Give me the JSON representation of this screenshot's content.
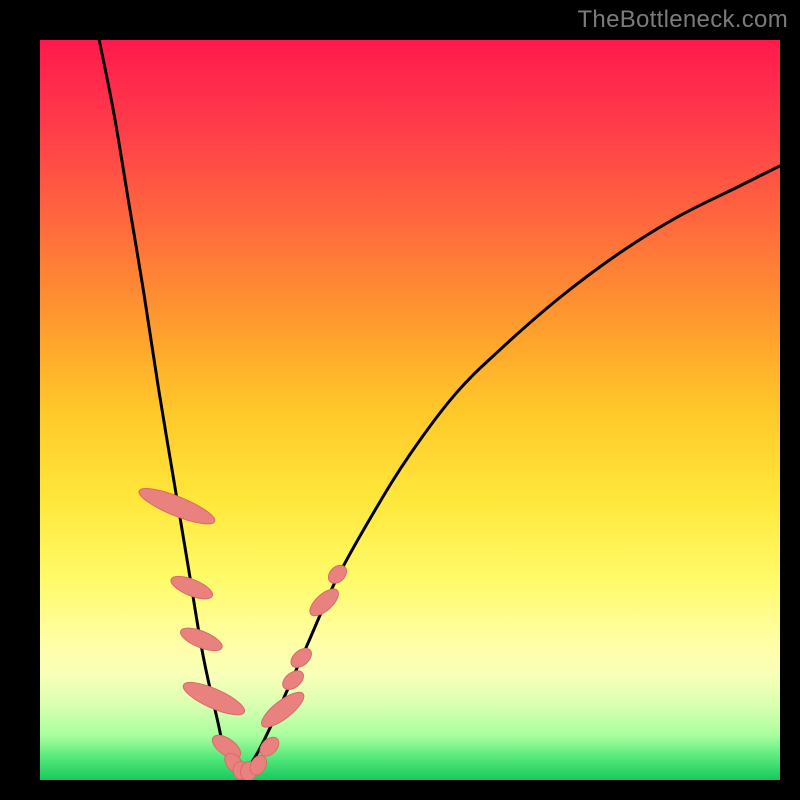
{
  "watermark": "TheBottleneck.com",
  "colors": {
    "background": "#000000",
    "curve": "#000000",
    "blob_fill": "#e9827f",
    "blob_stroke": "#d86b68"
  },
  "chart_data": {
    "type": "line",
    "title": "",
    "xlabel": "",
    "ylabel": "",
    "xlim": [
      0,
      100
    ],
    "ylim": [
      0,
      100
    ],
    "legend": false,
    "grid": false,
    "notes": "Bottleneck curve: y≈0 at optimum (~x≈25–29); steep left branch x∈[8,25], shallow right branch x∈[29,100]. Pink blobs mark data points clustered in the valley and lower slopes (y≤30).",
    "series": [
      {
        "name": "left-branch",
        "x": [
          8,
          10,
          12,
          14,
          16,
          18,
          20,
          22,
          24,
          25,
          27
        ],
        "values": [
          100,
          90,
          78,
          66,
          53,
          41,
          29,
          17,
          8,
          4,
          1
        ]
      },
      {
        "name": "right-branch",
        "x": [
          27,
          29,
          32,
          36,
          40,
          45,
          50,
          56,
          62,
          70,
          78,
          86,
          94,
          100
        ],
        "values": [
          1,
          3,
          9,
          18,
          27,
          36,
          44,
          52,
          58,
          65,
          71,
          76,
          80,
          83
        ]
      }
    ],
    "blobs": [
      {
        "cx": 18.5,
        "cy": 37,
        "rx": 1.3,
        "ry": 5.5,
        "rot": -68
      },
      {
        "cx": 20.5,
        "cy": 26,
        "rx": 1.1,
        "ry": 3.0,
        "rot": -68
      },
      {
        "cx": 21.8,
        "cy": 19,
        "rx": 1.1,
        "ry": 3.0,
        "rot": -68
      },
      {
        "cx": 23.5,
        "cy": 11,
        "rx": 1.3,
        "ry": 4.5,
        "rot": -66
      },
      {
        "cx": 25.2,
        "cy": 4.5,
        "rx": 1.1,
        "ry": 2.2,
        "rot": -55
      },
      {
        "cx": 26.2,
        "cy": 2.3,
        "rx": 1.0,
        "ry": 1.5,
        "rot": -40
      },
      {
        "cx": 27.1,
        "cy": 1.3,
        "rx": 1.0,
        "ry": 1.2,
        "rot": 0
      },
      {
        "cx": 28.2,
        "cy": 1.2,
        "rx": 1.1,
        "ry": 1.3,
        "rot": 10
      },
      {
        "cx": 29.5,
        "cy": 2.0,
        "rx": 1.0,
        "ry": 1.4,
        "rot": 30
      },
      {
        "cx": 31.0,
        "cy": 4.5,
        "rx": 1.0,
        "ry": 1.5,
        "rot": 45
      },
      {
        "cx": 32.8,
        "cy": 9.5,
        "rx": 1.2,
        "ry": 3.5,
        "rot": 52
      },
      {
        "cx": 34.2,
        "cy": 13.5,
        "rx": 1.0,
        "ry": 1.6,
        "rot": 52
      },
      {
        "cx": 35.3,
        "cy": 16.5,
        "rx": 1.0,
        "ry": 1.6,
        "rot": 50
      },
      {
        "cx": 38.4,
        "cy": 24.0,
        "rx": 1.1,
        "ry": 2.4,
        "rot": 48
      },
      {
        "cx": 40.2,
        "cy": 27.8,
        "rx": 1.0,
        "ry": 1.4,
        "rot": 46
      }
    ]
  }
}
